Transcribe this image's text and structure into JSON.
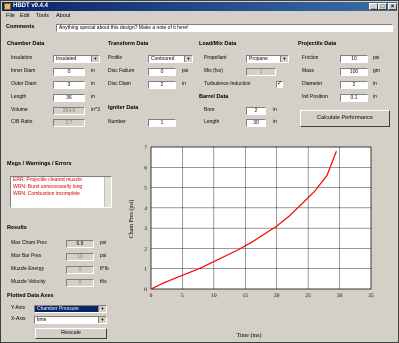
{
  "window": {
    "title": "HBDT v0.4.4",
    "minimize": "_",
    "maximize": "□",
    "close": "×"
  },
  "menu": [
    "File",
    "Edit",
    "Tools",
    "About"
  ],
  "comments": {
    "label": "Comments",
    "value": "Anything special about this design? Make a note of it here!"
  },
  "chamber": {
    "header": "Chamber Data",
    "insulation": {
      "label": "Insulation",
      "value": "Insulated"
    },
    "inner_diam": {
      "label": "Inner Diam",
      "value": "0",
      "unit": "in"
    },
    "outer_diam": {
      "label": "Outer Diam",
      "value": "3",
      "unit": "in"
    },
    "length": {
      "label": "Length",
      "value": "36",
      "unit": "in"
    },
    "volume": {
      "label": "Volume",
      "value": "254.5",
      "unit": "in^3"
    },
    "cb_ratio": {
      "label": "C/B Ratio",
      "value": "2.7"
    }
  },
  "transform": {
    "header": "Transform Data",
    "profile": {
      "label": "Profile",
      "value": "Contoured"
    },
    "disc_failure": {
      "label": "Disc Failure",
      "value": "0",
      "unit": "psi"
    },
    "disc_diam": {
      "label": "Disc Diam",
      "value": "2",
      "unit": "in"
    }
  },
  "igniter": {
    "header": "Igniter Data",
    "number": {
      "label": "Number",
      "value": "1"
    }
  },
  "load_mix": {
    "header": "Load/Mix Data",
    "propellant": {
      "label": "Propellant",
      "value": "Propane"
    },
    "mix": {
      "label": "Mix (fsx)",
      "value": "1"
    },
    "turbulence": {
      "label": "Turbulence Induction",
      "checked": "✓"
    }
  },
  "barrel": {
    "header": "Barrel Data",
    "bore": {
      "label": "Bore",
      "value": "2",
      "unit": "in"
    },
    "length": {
      "label": "Length",
      "value": "30",
      "unit": "in"
    }
  },
  "projectile": {
    "header": "Projectile Data",
    "friction": {
      "label": "Friction",
      "value": "10",
      "unit": "psi"
    },
    "mass": {
      "label": "Mass",
      "value": "100",
      "unit": "gm"
    },
    "diameter": {
      "label": "Diameter",
      "value": "2",
      "unit": "in"
    },
    "init_position": {
      "label": "Init Position",
      "value": "0.1",
      "unit": "in"
    }
  },
  "calculate_button": "Calculate Performance",
  "messages": {
    "header": "Msgs / Warnings / Errors",
    "items": [
      "ERR: Projectile cleared muzzle",
      "WRN: Burst unnecessarily long",
      "WRN: Combustion incomplete"
    ]
  },
  "results": {
    "header": "Results",
    "max_cham_pres": {
      "label": "Max Cham Pres",
      "value": "6.9",
      "unit": "psi"
    },
    "max_bar_pres": {
      "label": "Max Bar Pres",
      "value": "10",
      "unit": "psi"
    },
    "muzzle_energy": {
      "label": "Muzzle Energy",
      "value": "0",
      "unit": "ft*lb"
    },
    "muzzle_velocity": {
      "label": "Muzzle Velocity",
      "value": "0",
      "unit": "ft/s"
    }
  },
  "plotted": {
    "header": "Plotted Data Axes",
    "yaxis": {
      "label": "Y-Axis",
      "value": "Chamber Pressure"
    },
    "xaxis": {
      "label": "X-Axis",
      "value": "time"
    },
    "rescale": "Rescale"
  },
  "colors": {
    "curve": "#ff0000",
    "grid": "#000000",
    "selection": "#0a246a"
  },
  "chart_data": {
    "type": "line",
    "title": "",
    "xlabel": "Time (ms)",
    "ylabel": "Cham Pres (psi)",
    "xlim": [
      0,
      35
    ],
    "ylim": [
      0,
      7
    ],
    "xticks": [
      0,
      5,
      10,
      15,
      20,
      25,
      30,
      35
    ],
    "yticks": [
      0,
      1,
      2,
      3,
      4,
      5,
      6,
      7
    ],
    "grid": true,
    "series": [
      {
        "x": [
          0,
          2,
          4,
          6,
          8,
          10,
          12,
          14,
          16,
          18,
          20,
          22,
          24,
          26,
          28,
          29.5
        ],
        "y": [
          0,
          0.3,
          0.55,
          0.8,
          1.05,
          1.35,
          1.65,
          1.95,
          2.3,
          2.7,
          3.1,
          3.6,
          4.2,
          4.8,
          5.6,
          6.8
        ]
      }
    ]
  }
}
